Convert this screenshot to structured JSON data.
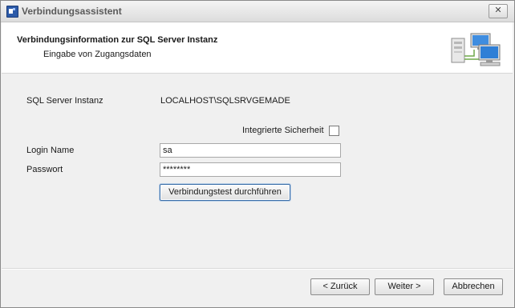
{
  "window": {
    "title": "Verbindungsassistent",
    "close_glyph": "✕"
  },
  "header": {
    "title": "Verbindungsinformation zur SQL Server Instanz",
    "subtitle": "Eingabe von Zugangsdaten",
    "icon": "network-computers-icon"
  },
  "form": {
    "instance_label": "SQL Server Instanz",
    "instance_value": "LOCALHOST\\SQLSRVGEMADE",
    "integrated_security_label": "Integrierte Sicherheit",
    "integrated_security_checked": false,
    "login_label": "Login Name",
    "login_value": "sa",
    "password_label": "Passwort",
    "password_value": "********",
    "test_button_label": "Verbindungstest durchführen"
  },
  "footer": {
    "back_label": "< Zurück",
    "next_label": "Weiter >",
    "cancel_label": "Abbrechen"
  },
  "colors": {
    "focus_border": "#3c6fa8",
    "window_bg": "#f0f0f0",
    "header_bg": "#ffffff"
  }
}
